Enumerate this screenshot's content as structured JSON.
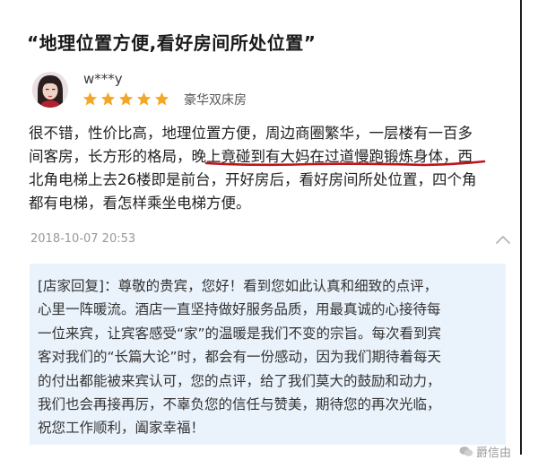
{
  "header": {
    "title": "“地理位置方便,看好房间所处位置”"
  },
  "reviewer": {
    "username": "w***y",
    "avatar_icon": "user-avatar",
    "rating": 5,
    "rating_max": 5,
    "room_type": "豪华双床房"
  },
  "review": {
    "lines": [
      "很不错，性价比高，地理位置方便，周边商圈繁华，一层楼有一百多",
      "间客房，长方形的格局，晚上竟碰到有大妈在过道慢跑锻炼身体，西",
      "北角电梯上去26楼即是前台，开好房后，看好房间所处位置，四个角",
      "都有电梯，看怎样乘坐电梯方便。"
    ],
    "date": "2018-10-07 20:53"
  },
  "reply": {
    "lines": [
      "[店家回复]：尊敬的贵宾，您好！看到您如此认真和细致的点评，",
      "心里一阵暖流。酒店一直坚持做好服务品质，用最真诚的心接待每",
      "一位来宾，让宾客感受“家”的温暖是我们不变的宗旨。每次看到宾",
      "客对我们的“长篇大论”时，都会有一份感动，因为我们期待着每天",
      "的付出都能被来宾认可，您的点评，给了我们莫大的鼓励和动力，",
      "我们也会再接再厉，不辜负您的信任与赞美，期待您的再次光临，",
      "祝您工作顺利，阖家幸福！"
    ]
  },
  "watermark": {
    "text": "爵信由",
    "icon": "wechat-icon"
  },
  "colors": {
    "star": "#f5a623",
    "underline": "#c0141b",
    "reply_bg": "#eaf2fb",
    "date": "#999999"
  }
}
